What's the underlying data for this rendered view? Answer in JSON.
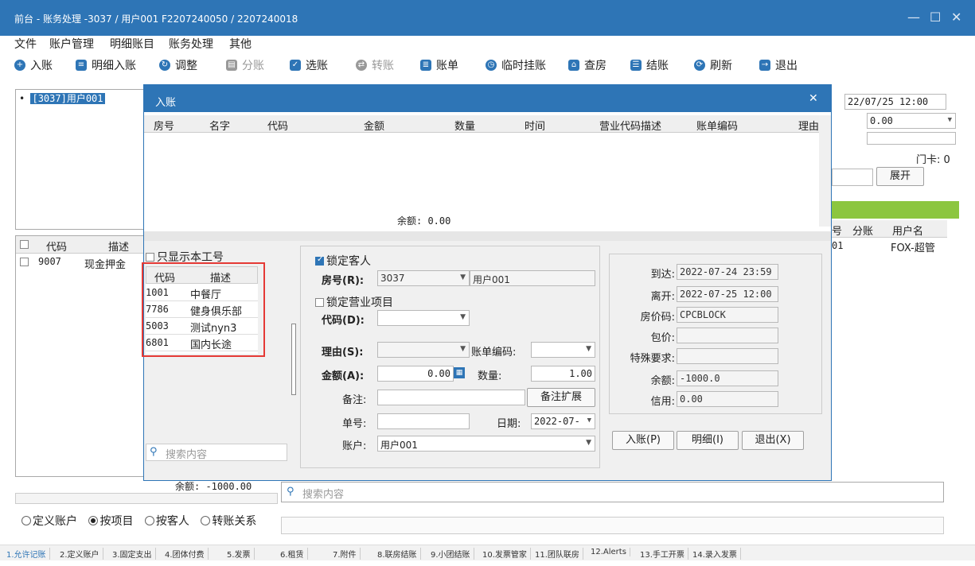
{
  "window": {
    "title": "前台 - 账务处理 -3037 / 用户001 F2207240050 / 2207240018"
  },
  "menu": [
    "文件",
    "账户管理",
    "明细账目",
    "账务处理",
    "其他"
  ],
  "toolbar": [
    {
      "label": "入账",
      "icon": "plus-circle-icon",
      "color": "#2e75b6",
      "disabled": false
    },
    {
      "label": "明细入账",
      "icon": "list-icon",
      "color": "#2e75b6",
      "disabled": false
    },
    {
      "label": "调整",
      "icon": "adjust-icon",
      "color": "#2e75b6",
      "disabled": false
    },
    {
      "label": "分账",
      "icon": "split-icon",
      "color": "#999999",
      "disabled": true
    },
    {
      "label": "选账",
      "icon": "select-icon",
      "color": "#2e75b6",
      "disabled": false
    },
    {
      "label": "转账",
      "icon": "transfer-icon",
      "color": "#999999",
      "disabled": true
    },
    {
      "label": "账单",
      "icon": "bill-icon",
      "color": "#2e75b6",
      "disabled": false
    },
    {
      "label": "临时挂账",
      "icon": "clock-icon",
      "color": "#2e75b6",
      "disabled": false
    },
    {
      "label": "查房",
      "icon": "house-icon",
      "color": "#2e75b6",
      "disabled": false
    },
    {
      "label": "结账",
      "icon": "stack-icon",
      "color": "#2e75b6",
      "disabled": false
    },
    {
      "label": "刷新",
      "icon": "refresh-icon",
      "color": "#2e75b6",
      "disabled": false
    },
    {
      "label": "退出",
      "icon": "exit-icon",
      "color": "#2e75b6",
      "disabled": false
    }
  ],
  "tree": {
    "item": "[3037]用户001"
  },
  "left_table": {
    "headers": [
      "代码",
      "描述"
    ],
    "row": {
      "code": "9007",
      "desc": "现金押金"
    },
    "balance": "余额: -1000.00"
  },
  "radios": [
    "定义账户",
    "按项目",
    "按客人",
    "转账关系"
  ],
  "right_behind": {
    "departure": "22/07/25 12:00",
    "rate": "0.00",
    "door_card": "门卡: 0",
    "expand": "展开",
    "col_headers": [
      "号",
      "分账",
      "用户名"
    ],
    "row": {
      "code": "01",
      "user": "FOX-超管"
    },
    "search_placeholder": "搜索内容"
  },
  "modal": {
    "title": "入账",
    "grid_headers": [
      "房号",
      "名字",
      "代码",
      "金额",
      "数量",
      "时间",
      "营业代码描述",
      "账单编码",
      "理由"
    ],
    "grid_balance": "余额: 0.00",
    "only_my_code": "只显示本工号",
    "code_table": {
      "headers": [
        "代码",
        "描述"
      ],
      "rows": [
        {
          "code": "1001",
          "desc": "中餐厅"
        },
        {
          "code": "7786",
          "desc": "健身俱乐部"
        },
        {
          "code": "5003",
          "desc": "测试nyn3"
        },
        {
          "code": "6801",
          "desc": "国内长途"
        }
      ]
    },
    "search_placeholder": "搜索内容",
    "lock_guest": "锁定客人",
    "room_label": "房号(R):",
    "room_value": "3037",
    "guest_name": "用户001",
    "lock_item": "锁定营业项目",
    "code_label": "代码(D):",
    "reason_label": "理由(S):",
    "bill_code_label": "账单编码:",
    "amount_label": "金额(A):",
    "amount_value": "0.00",
    "qty_label": "数量:",
    "qty_value": "1.00",
    "remark_label": "备注:",
    "remark_expand": "备注扩展",
    "order_label": "单号:",
    "date_label": "日期:",
    "date_value": "2022-07-",
    "account_label": "账户:",
    "account_value": "用户001",
    "info": {
      "arrive_label": "到达:",
      "arrive": "2022-07-24 23:59",
      "depart_label": "离开:",
      "depart": "2022-07-25 12:00",
      "rate_code_label": "房价码:",
      "rate_code": "CPCBLOCK",
      "package_label": "包价:",
      "package": "",
      "special_label": "特殊要求:",
      "special": "",
      "balance_label": "余额:",
      "balance": "-1000.0",
      "credit_label": "信用:",
      "credit": "0.00"
    },
    "post_btn": "入账(P)",
    "detail_btn": "明细(I)",
    "exit_btn": "退出(X)"
  },
  "bottom_tabs": [
    "1.允许记账",
    "2.定义账户",
    "3.固定支出",
    "4.团体付费",
    "5.发票",
    "6.租赁",
    "7.附件",
    "8.联房结账",
    "9.小团结账",
    "10.发票管家",
    "11.团队联房",
    "12.Alerts",
    "13.手工开票",
    "14.录入发票"
  ],
  "colors": {
    "accent": "#2e75b6",
    "highlight_box": "#e53935",
    "green_bar": "#8cc63f"
  }
}
